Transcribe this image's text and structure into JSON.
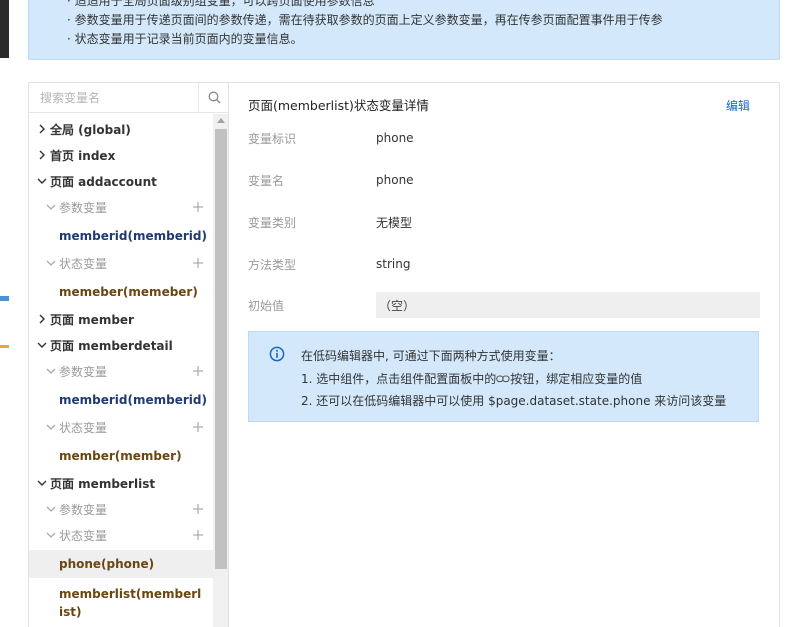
{
  "notice": {
    "line_cut": "· 适适用于全局页面级别组变量，可以跨页面使用参数信息",
    "line2": "· 参数变量用于传递页面间的参数传递，需在待获取参数的页面上定义参数变量，再在传参页面配置事件用于传参",
    "line3": "· 状态变量用于记录当前页面内的变量信息。"
  },
  "search": {
    "placeholder": "搜索变量名"
  },
  "tree": {
    "global": "全局 (global)",
    "index": "首页 index",
    "addaccount": "页面 addaccount",
    "addaccount_param": "参数变量",
    "addaccount_param_item": "memberid(memberid)",
    "addaccount_state": "状态变量",
    "addaccount_state_item": "memeber(memeber)",
    "member": "页面 member",
    "memberdetail": "页面 memberdetail",
    "memberdetail_param": "参数变量",
    "memberdetail_param_item": "memberid(memberid)",
    "memberdetail_state": "状态变量",
    "memberdetail_state_item": "member(member)",
    "memberlist": "页面 memberlist",
    "memberlist_param": "参数变量",
    "memberlist_state": "状态变量",
    "memberlist_state_item1": "phone(phone)",
    "memberlist_state_item2": "memberlist(memberlist)"
  },
  "detail": {
    "title": "页面(memberlist)状态变量详情",
    "edit_label": "编辑",
    "fields": [
      {
        "key": "变量标识",
        "value": "phone"
      },
      {
        "key": "变量名",
        "value": "phone"
      },
      {
        "key": "变量类别",
        "value": "无模型"
      },
      {
        "key": "方法类型",
        "value": "string"
      },
      {
        "key": "初始值",
        "value": "（空）"
      }
    ],
    "info": {
      "line1": "在低码编辑器中, 可通过下面两种方式使用变量：",
      "line2_a": "1. 选中组件，点击组件配置面板中的",
      "line2_b": "按钮，绑定相应变量的值",
      "line3": "2. 还可以在低码编辑器中可以使用 $page.dataset.state.phone 来访问该变量"
    }
  },
  "colors": {
    "accent": "#1967c6",
    "notice_bg": "#d3e8fb",
    "leaf_blue": "#1f3b73",
    "leaf_brown": "#6b4610"
  },
  "icons": {
    "search": "search-icon",
    "caret_right": "chevron-right-icon",
    "caret_down": "chevron-down-icon",
    "plus": "plus-icon",
    "info": "info-icon",
    "link": "link-icon"
  }
}
